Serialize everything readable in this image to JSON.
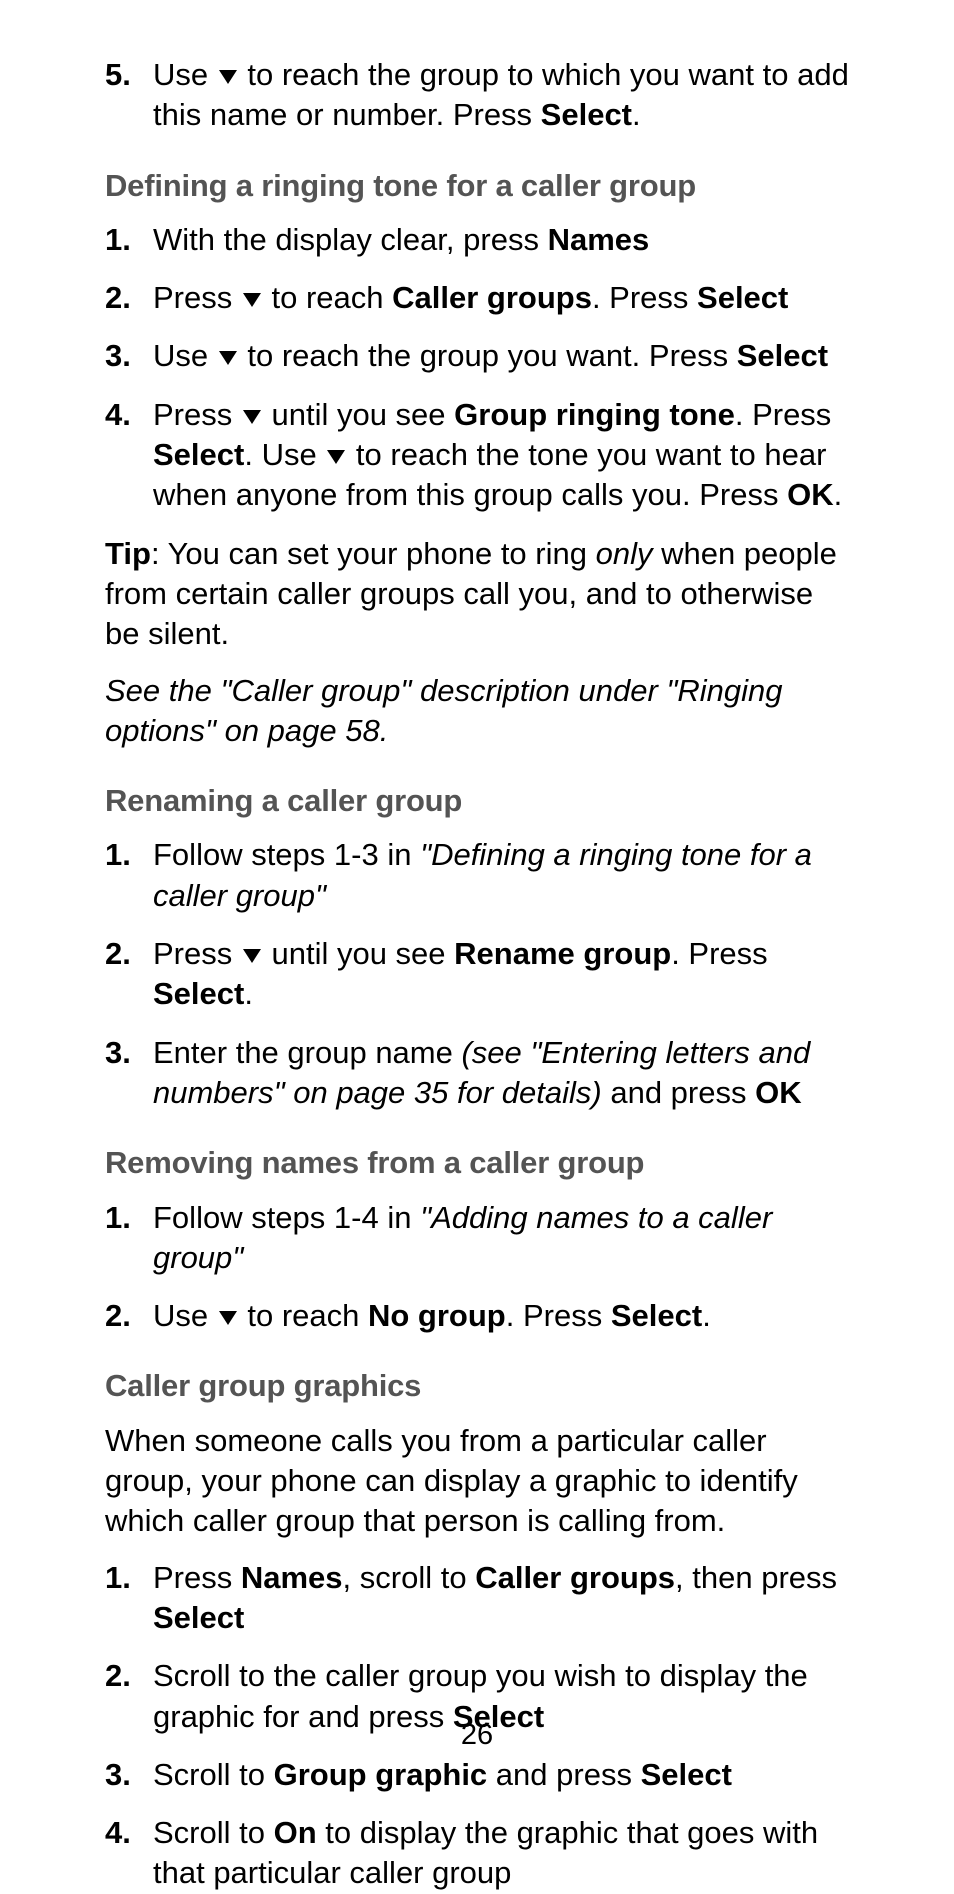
{
  "prev_step": {
    "marker": "5.",
    "pre": "Use ",
    "post": " to reach the group to which you want to add this name or number. Press ",
    "btn": "Select",
    "tail": "."
  },
  "sec1": {
    "title": "Defining a ringing tone for a caller group",
    "steps": {
      "s1": {
        "marker": "1.",
        "a": "With the display clear, press ",
        "b": "Names"
      },
      "s2": {
        "marker": "2.",
        "a": "Press ",
        "b": " to reach ",
        "c": "Caller groups",
        "d": ". Press ",
        "e": "Select"
      },
      "s3": {
        "marker": "3.",
        "a": "Use ",
        "b": " to reach the group you want. Press ",
        "c": "Select"
      },
      "s4": {
        "marker": "4.",
        "a": "Press ",
        "b": " until you see ",
        "c": "Group ringing tone",
        "d": ". Press ",
        "e": "Select",
        "f": ". Use ",
        "g": " to reach the tone you want to hear when anyone from this group calls you. Press ",
        "h": "OK",
        "i": "."
      }
    },
    "tip_label": "Tip",
    "tip_a": ": You can set your phone to ring ",
    "tip_em": "only",
    "tip_b": " when people from certain caller groups call you, and to otherwise be silent.",
    "ref": "See the \"Caller group\" description under \"Ringing options\" on page 58."
  },
  "sec2": {
    "title": "Renaming a caller group",
    "steps": {
      "s1": {
        "marker": "1.",
        "a": "Follow steps 1-3 in ",
        "em": "\"Defining a ringing tone for a caller group\""
      },
      "s2": {
        "marker": "2.",
        "a": "Press ",
        "b": " until you see ",
        "c": "Rename group",
        "d": ". Press ",
        "e": "Select",
        "f": "."
      },
      "s3": {
        "marker": "3.",
        "a": "Enter the group name ",
        "em": "(see \"Entering letters and numbers\" on page 35 for details)",
        "b": " and press ",
        "c": "OK"
      }
    }
  },
  "sec3": {
    "title": "Removing names from a caller group",
    "steps": {
      "s1": {
        "marker": "1.",
        "a": "Follow steps 1-4 in ",
        "em": "\"Adding names to a caller group\""
      },
      "s2": {
        "marker": "2.",
        "a": "Use ",
        "b": " to reach ",
        "c": "No group",
        "d": ". Press ",
        "e": "Select",
        "f": "."
      }
    }
  },
  "sec4": {
    "title": "Caller group graphics",
    "intro": "When someone calls you from a particular caller group, your phone can display a graphic to identify which caller group that person is calling from.",
    "steps": {
      "s1": {
        "marker": "1.",
        "a": "Press ",
        "b": "Names",
        "c": ", scroll to ",
        "d": "Caller groups",
        "e": ", then press ",
        "f": "Select"
      },
      "s2": {
        "marker": "2.",
        "a": "Scroll to the caller group you wish to display the graphic for and press ",
        "b": "Select"
      },
      "s3": {
        "marker": "3.",
        "a": "Scroll to ",
        "b": "Group graphic",
        "c": " and press ",
        "d": "Select"
      },
      "s4": {
        "marker": "4.",
        "a": "Scroll to ",
        "b": "On",
        "c": " to display the graphic that goes with that particular caller group"
      }
    }
  },
  "page_number": "26"
}
